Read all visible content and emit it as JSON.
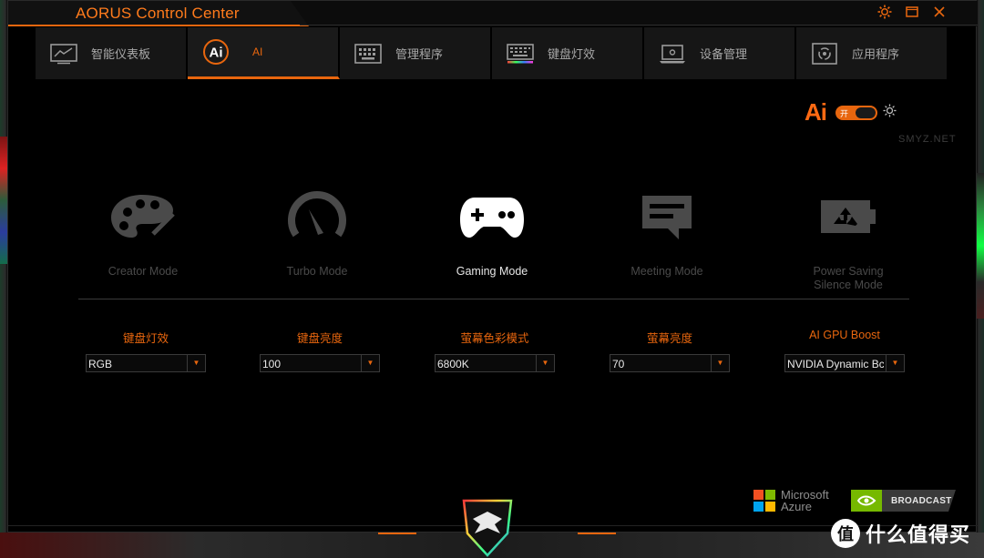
{
  "app": {
    "title": "AORUS Control Center"
  },
  "window_controls": [
    "gear-icon",
    "maximize-icon",
    "close-icon"
  ],
  "tabs": [
    {
      "label": "智能仪表板",
      "icon": "dashboard-icon"
    },
    {
      "label": "AI",
      "icon": "ai-icon",
      "active": true
    },
    {
      "label": "管理程序",
      "icon": "keyboard-macro-icon"
    },
    {
      "label": "键盘灯效",
      "icon": "keyboard-rgb-icon"
    },
    {
      "label": "设备管理",
      "icon": "laptop-icon"
    },
    {
      "label": "应用程序",
      "icon": "apps-icon"
    }
  ],
  "ai_toggle": {
    "logo": "Ai",
    "switch_text": "开",
    "state": "on"
  },
  "modes": [
    {
      "label": "Creator Mode",
      "icon": "palette-icon"
    },
    {
      "label": "Turbo Mode",
      "icon": "speedometer-icon"
    },
    {
      "label": "Gaming Mode",
      "icon": "gamepad-icon",
      "active": true
    },
    {
      "label": "Meeting Mode",
      "icon": "chat-icon"
    },
    {
      "label_line1": "Power Saving",
      "label_line2": "Silence Mode",
      "icon": "battery-recycle-icon"
    }
  ],
  "settings": [
    {
      "label": "键盘灯效",
      "value": "RGB"
    },
    {
      "label": "键盘亮度",
      "value": "100"
    },
    {
      "label": "萤幕色彩模式",
      "value": "6800K"
    },
    {
      "label": "萤幕亮度",
      "value": "70"
    },
    {
      "label": "AI GPU Boost",
      "value": "NVIDIA Dynamic Bc"
    }
  ],
  "partners": {
    "microsoft_line1": "Microsoft",
    "microsoft_line2": "Azure",
    "nvidia": "BROADCAST"
  },
  "watermark": {
    "circle": "值",
    "text": "什么值得买",
    "side": "SMYZ.NET"
  },
  "colors": {
    "accent": "#e8660e",
    "active_text": "#e6e6e6",
    "inactive_text": "#4a4a4a"
  }
}
